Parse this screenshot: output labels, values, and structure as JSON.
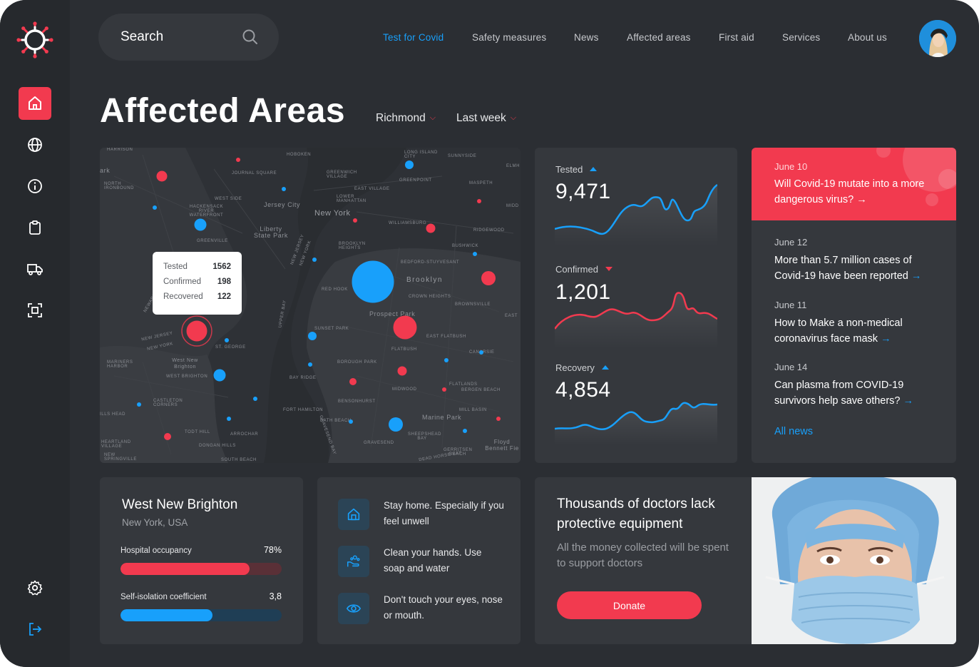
{
  "search": {
    "placeholder": "Search"
  },
  "nav": {
    "items": [
      "Test for Covid",
      "Safety measures",
      "News",
      "Affected areas",
      "First aid",
      "Services",
      "About us"
    ],
    "active_color": "#18a0fb"
  },
  "page": {
    "title": "Affected Areas",
    "filters": {
      "location": "Richmond",
      "period": "Last week"
    }
  },
  "colors": {
    "accent_red": "#f23a4f",
    "accent_blue": "#18a0fb",
    "background": "#2b2e33",
    "card": "#35383d"
  },
  "map": {
    "labels": {
      "harrison": "Harrison",
      "park": "ark",
      "hoboken": "Hoboken",
      "long_island_city": "Long Island City",
      "sunnyside": "Sunnyside",
      "elmh": "Elmh",
      "north_ironbound": "North Ironbound",
      "journal_square": "Journal Square",
      "greenwich_village": "Greenwich Village",
      "east_village": "East Village",
      "greenpoint": "Greenpoint",
      "maspeth": "Maspeth",
      "midd": "Midd",
      "west_side": "West Side",
      "jersey_city": "Jersey City",
      "new_york": "New York",
      "lower_manhattan": "Lower Manhattan",
      "hackensack": "Hackensack River Waterfront",
      "williamsburg": "Williamsburg",
      "ridgewood": "Ridgewood",
      "liberty": "Liberty State Park",
      "greenville": "Greenville",
      "new_jersey_rot": "New Jersey",
      "new_york_rot": "New York",
      "brooklyn_heights": "Brooklyn Heights",
      "bushwick": "Bushwick",
      "bedford": "Bedford-Stuyvesant",
      "brooklyn": "Brooklyn",
      "red_hook": "Red Hook",
      "crown_heights": "Crown Heights",
      "brownsville": "Brownsville",
      "east": "East",
      "prospect_park": "Prospect Park",
      "newark_bay": "Newark Bay",
      "upper_bay": "Upper Bay",
      "sunset_park": "Sunset Park",
      "east_flatbush": "East Flatbush",
      "new_jersey": "New Jersey",
      "new_york_2": "New York",
      "st_george": "St. George",
      "flatbush": "Flatbush",
      "canarsie": "Canarsie",
      "mariners_harbor": "Mariners Harbor",
      "west_new_brighton": "West New Brighton",
      "west_brighton": "West Brighton",
      "borough_park": "Borough Park",
      "bay_ridge": "Bay Ridge",
      "midwood": "Midwood",
      "flatlands": "Flatlands",
      "bergen_beach": "Bergen Beach",
      "castleton": "Castleton Corners",
      "bensonhurst": "Bensonhurst",
      "mill_basin": "Mill Basin",
      "hills_head": "ills Head",
      "fort_hamilton": "Fort Hamilton",
      "bath_beach": "Bath Beach",
      "marine_park": "Marine Park",
      "sheepshead_bay": "Sheepshead Bay",
      "gravesend": "Gravesend",
      "todt_hill": "Todt Hill",
      "arrochar": "Arrochar",
      "floyd": "Floyd Bennett Fie",
      "heartland": "Heartland Village",
      "new_springville": "New Springville",
      "dongan_hills": "Dongan Hills",
      "gerritsen": "Gerritsen Beach",
      "south_beach": "South Beach",
      "gravesend_bay": "Gravesend Bay",
      "dead_horse": "Dead Horse Bay"
    },
    "tooltip": {
      "rows": [
        {
          "label": "Tested",
          "value": "1562"
        },
        {
          "label": "Confirmed",
          "value": "198"
        },
        {
          "label": "Recovered",
          "value": "122"
        }
      ]
    }
  },
  "stats": [
    {
      "label": "Tested",
      "value": "9,471",
      "trend": "up",
      "color": "#18a0fb"
    },
    {
      "label": "Confirmed",
      "value": "1,201",
      "trend": "down",
      "color": "#f23a4f"
    },
    {
      "label": "Recovery",
      "value": "4,854",
      "trend": "up",
      "color": "#18a0fb"
    }
  ],
  "news": {
    "featured": {
      "date": "June 10",
      "text": "Will Covid-19  mutate into a more dangerous virus?",
      "arrow": "→"
    },
    "items": [
      {
        "date": "June 12",
        "text": "More than 5.7 million cases of Covid-19 have been reported",
        "arrow": "→"
      },
      {
        "date": "June 11",
        "text": "How to Make a non-medical coronavirus face mask",
        "arrow": "→"
      },
      {
        "date": "June 14",
        "text": "Can plasma from COVID-19 survivors help save others?",
        "arrow": "→"
      }
    ],
    "all_news": "All news"
  },
  "location_card": {
    "title": "West New Brighton",
    "subtitle": "New York, USA",
    "metrics": [
      {
        "label": "Hospital occupancy",
        "value": "78%",
        "fraction": 0.8,
        "color": "#f23a4f",
        "track": "#5a3037"
      },
      {
        "label": "Self-isolation coefficient",
        "value": "3,8",
        "fraction": 0.57,
        "color": "#18a0fb",
        "track": "#1f3e55"
      }
    ]
  },
  "tips": [
    {
      "icon": "home-icon",
      "text": "Stay home. Especially if you feel unwell"
    },
    {
      "icon": "wash-hands-icon",
      "text": "Clean your hands. Use soap and water"
    },
    {
      "icon": "eye-icon",
      "text": "Don't touch your eyes, nose or mouth."
    }
  ],
  "donate": {
    "title": "Thousands of doctors lack protective equipment",
    "subtitle": "All the money collected will be spent to support doctors",
    "button": "Donate"
  }
}
